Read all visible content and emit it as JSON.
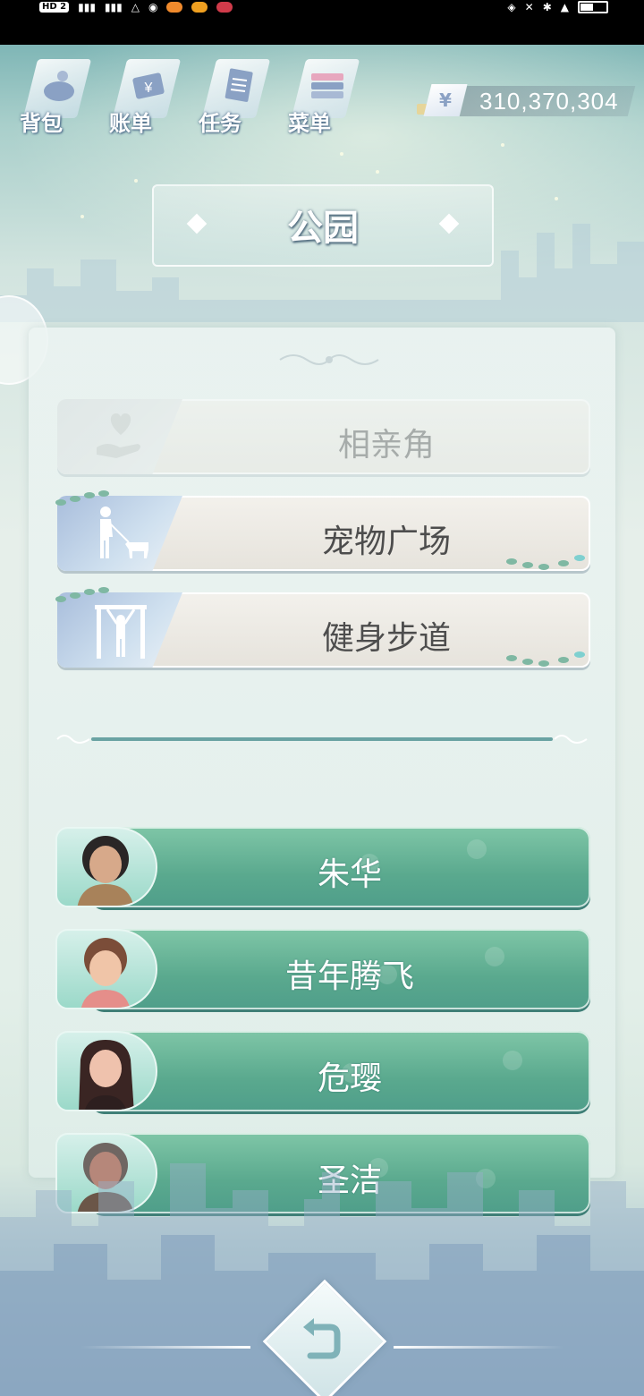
{
  "status_bar": {
    "network_badge": "HD 2"
  },
  "top_nav": {
    "items": [
      {
        "label": "背包",
        "icon": "bag-icon"
      },
      {
        "label": "账单",
        "icon": "bill-icon"
      },
      {
        "label": "任务",
        "icon": "task-icon"
      },
      {
        "label": "菜单",
        "icon": "menu-icon"
      }
    ]
  },
  "currency": {
    "symbol": "¥",
    "amount": "310,370,304"
  },
  "location": {
    "title": "公园"
  },
  "places": [
    {
      "label": "相亲角",
      "icon": "heart-hand-icon",
      "enabled": false
    },
    {
      "label": "宠物广场",
      "icon": "dog-walker-icon",
      "enabled": true
    },
    {
      "label": "健身步道",
      "icon": "fitness-bars-icon",
      "enabled": true
    }
  ],
  "npcs": [
    {
      "name": "朱华"
    },
    {
      "name": "昔年腾飞"
    },
    {
      "name": "危璎"
    },
    {
      "name": "圣洁"
    }
  ],
  "colors": {
    "accent_green": "#5aa98e",
    "divider": "#6aa3a3",
    "title_shadow": "#4e6a7d"
  }
}
